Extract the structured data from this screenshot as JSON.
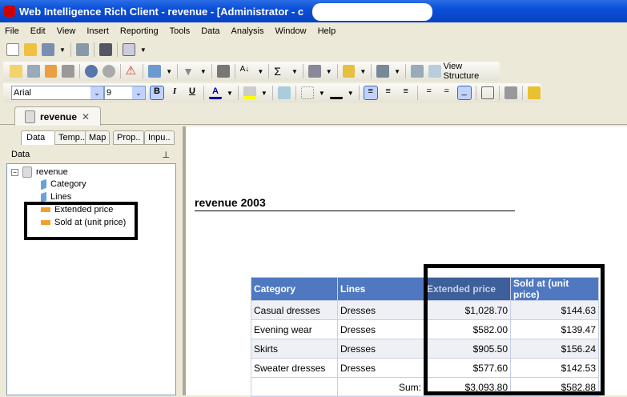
{
  "window": {
    "title": "Web Intelligence Rich Client - revenue - [Administrator - c"
  },
  "menu": [
    "File",
    "Edit",
    "View",
    "Insert",
    "Reporting",
    "Tools",
    "Data",
    "Analysis",
    "Window",
    "Help"
  ],
  "toolbar": {
    "view_structure": "View Structure",
    "font": "Arial",
    "size": "9",
    "bold": "B",
    "italic": "I",
    "underline": "U",
    "font_color": "A"
  },
  "doc_tab": {
    "label": "revenue",
    "close": "✕"
  },
  "left_panel": {
    "tabs": [
      "Data",
      "Temp..",
      "Map",
      "Prop..",
      "Inpu.."
    ],
    "header": "Data",
    "pin": "⊥",
    "tree": {
      "root": "revenue",
      "dimensions": [
        "Category",
        "Lines"
      ],
      "measures": [
        "Extended price",
        "Sold at (unit price)"
      ]
    }
  },
  "report": {
    "title": "revenue 2003",
    "table": {
      "headers": [
        "Category",
        "Lines",
        "Extended price",
        "Sold at (unit price)"
      ],
      "rows": [
        [
          "Casual dresses",
          "Dresses",
          "$1,028.70",
          "$144.63"
        ],
        [
          "Evening wear",
          "Dresses",
          "$582.00",
          "$139.47"
        ],
        [
          "Skirts",
          "Dresses",
          "$905.50",
          "$156.24"
        ],
        [
          "Sweater dresses",
          "Dresses",
          "$577.60",
          "$142.53"
        ]
      ],
      "sum_label": "Sum:",
      "sums": [
        "$3,093.80",
        "$582.88"
      ]
    }
  },
  "colors": {
    "header": "#4f78c0",
    "selected_header": "#3d5f9a",
    "titlebar": "#0a4fd8"
  }
}
